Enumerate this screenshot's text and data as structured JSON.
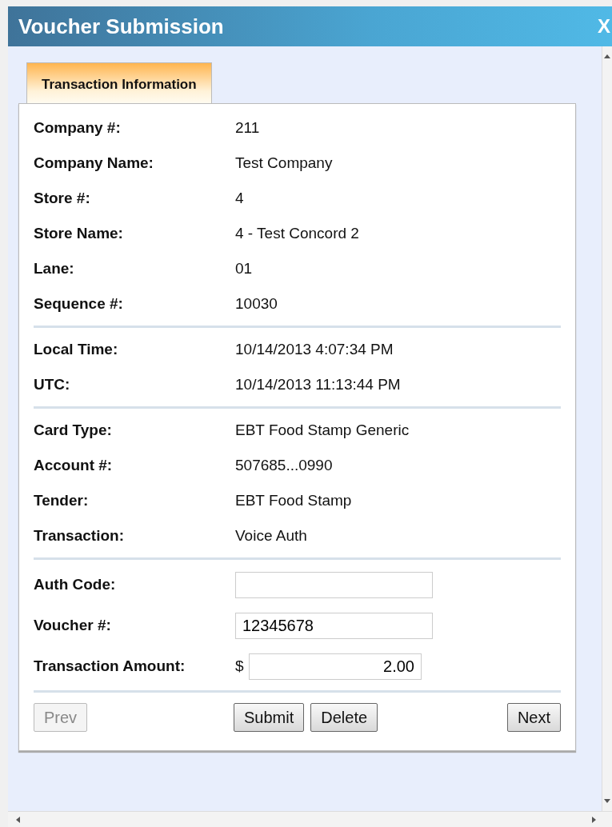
{
  "window": {
    "title": "Voucher Submission",
    "close": "X"
  },
  "tabs": [
    {
      "label": "Transaction Information",
      "selected": true
    }
  ],
  "sections": [
    {
      "fields": [
        {
          "label": "Company #:",
          "value": "211"
        },
        {
          "label": "Company Name:",
          "value": "Test Company"
        },
        {
          "label": "Store #:",
          "value": "4"
        },
        {
          "label": "Store Name:",
          "value": "4 - Test Concord 2"
        },
        {
          "label": "Lane:",
          "value": "01"
        },
        {
          "label": "Sequence #:",
          "value": "10030"
        }
      ]
    },
    {
      "fields": [
        {
          "label": "Local Time:",
          "value": "10/14/2013 4:07:34 PM"
        },
        {
          "label": "UTC:",
          "value": "10/14/2013 11:13:44 PM"
        }
      ]
    },
    {
      "fields": [
        {
          "label": "Card Type:",
          "value": "EBT Food Stamp Generic"
        },
        {
          "label": "Account #:",
          "value": "507685...0990"
        },
        {
          "label": "Tender:",
          "value": "EBT Food Stamp"
        },
        {
          "label": "Transaction:",
          "value": "Voice Auth"
        }
      ]
    }
  ],
  "form": [
    {
      "kind": "text",
      "label": "Auth Code:"
    },
    {
      "kind": "text",
      "label": "Voucher #:",
      "value": "12345678"
    },
    {
      "kind": "currency",
      "label": "Transaction Amount:",
      "prefix": "$",
      "value": "2.00"
    }
  ],
  "button_groups": [
    {
      "buttons": [
        {
          "label": "Prev",
          "disabled": true
        }
      ]
    },
    {
      "buttons": [
        {
          "label": "Submit",
          "disabled": false
        },
        {
          "label": "Delete",
          "disabled": false
        }
      ]
    },
    {
      "buttons": [
        {
          "label": "Next",
          "disabled": false
        }
      ]
    }
  ]
}
